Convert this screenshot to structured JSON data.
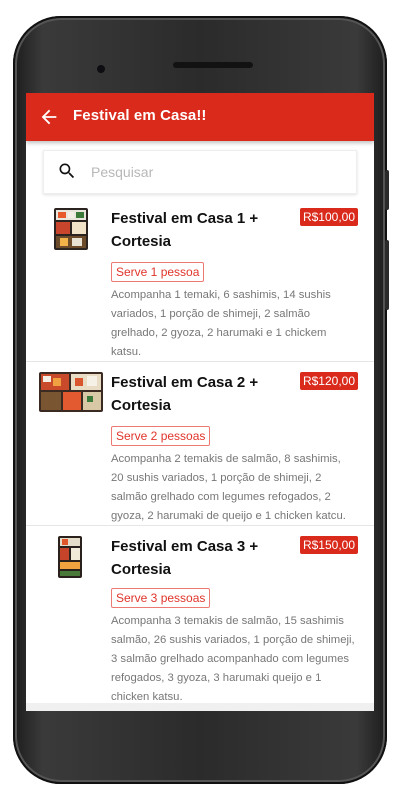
{
  "appbar": {
    "title": "Festival em Casa!!",
    "back_icon": "arrow-left-icon",
    "color": "#d92a1c"
  },
  "search": {
    "placeholder": "Pesquisar",
    "value": "",
    "icon": "search-icon"
  },
  "items": [
    {
      "title": "Festival em Casa 1 + Cortesia",
      "price": "R$100,00",
      "serve": "Serve 1 pessoa",
      "description": "Acompanha 1 temaki, 6 sashimis, 14 sushis variados, 1 porção de shimeji, 2 salmão grelhado, 2 gyoza, 2 harumaki e 1 chickem katsu."
    },
    {
      "title": "Festival em Casa 2 + Cortesia",
      "price": "R$120,00",
      "serve": "Serve 2 pessoas",
      "description": "Acompanha 2 temakis de salmão, 8 sashimis, 20 sushis variados, 1 porção de shimeji, 2 salmão grelhado com legumes refogados, 2 gyoza, 2 harumaki de queijo e 1 chicken katcu."
    },
    {
      "title": "Festival em Casa 3 + Cortesia",
      "price": "R$150,00",
      "serve": "Serve 3 pessoas",
      "description": "Acompanha 3 temakis de salmão, 15 sashimis salmão, 26 sushis variados, 1 porção de shimeji, 3 salmão grelhado acompanhado com legumes refogados, 3 gyoza, 3 harumaki queijo e 1 chicken katsu."
    }
  ]
}
